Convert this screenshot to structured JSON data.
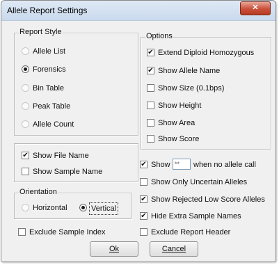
{
  "window": {
    "title": "Allele Report Settings",
    "close_symbol": "✕"
  },
  "report_style": {
    "legend": "Report Style",
    "options": [
      {
        "label": "Allele List",
        "selected": false
      },
      {
        "label": "Forensics",
        "selected": true
      },
      {
        "label": "Bin Table",
        "selected": false
      },
      {
        "label": "Peak Table",
        "selected": false
      },
      {
        "label": "Allele Count",
        "selected": false
      }
    ]
  },
  "file_options": {
    "show_file_name": {
      "label": "Show File Name",
      "checked": true
    },
    "show_sample_name": {
      "label": "Show Sample Name",
      "checked": false
    }
  },
  "orientation": {
    "legend": "Orientation",
    "horizontal": {
      "label": "Horizontal",
      "selected": false
    },
    "vertical": {
      "label": "Vertical",
      "selected": true
    }
  },
  "exclude_sample_index": {
    "label": "Exclude Sample Index",
    "checked": false
  },
  "options": {
    "legend": "Options",
    "items": [
      {
        "label": "Extend Diploid Homozygous",
        "checked": true
      },
      {
        "label": "Show Allele Name",
        "checked": true
      },
      {
        "label": "Show Size (0.1bps)",
        "checked": false
      },
      {
        "label": "Show Height",
        "checked": false
      },
      {
        "label": "Show Area",
        "checked": false
      },
      {
        "label": "Show Score",
        "checked": false
      }
    ]
  },
  "no_call": {
    "show_label": "Show",
    "checked": true,
    "value": "**",
    "suffix": "when no allele call"
  },
  "extra_options": [
    {
      "label": "Show Only Uncertain Alleles",
      "checked": false
    },
    {
      "label": "Show Rejected Low Score Alleles",
      "checked": true
    },
    {
      "label": "Hide Extra Sample Names",
      "checked": true
    },
    {
      "label": "Exclude Report Header",
      "checked": false
    }
  ],
  "buttons": {
    "ok": "Ok",
    "cancel": "Cancel"
  }
}
